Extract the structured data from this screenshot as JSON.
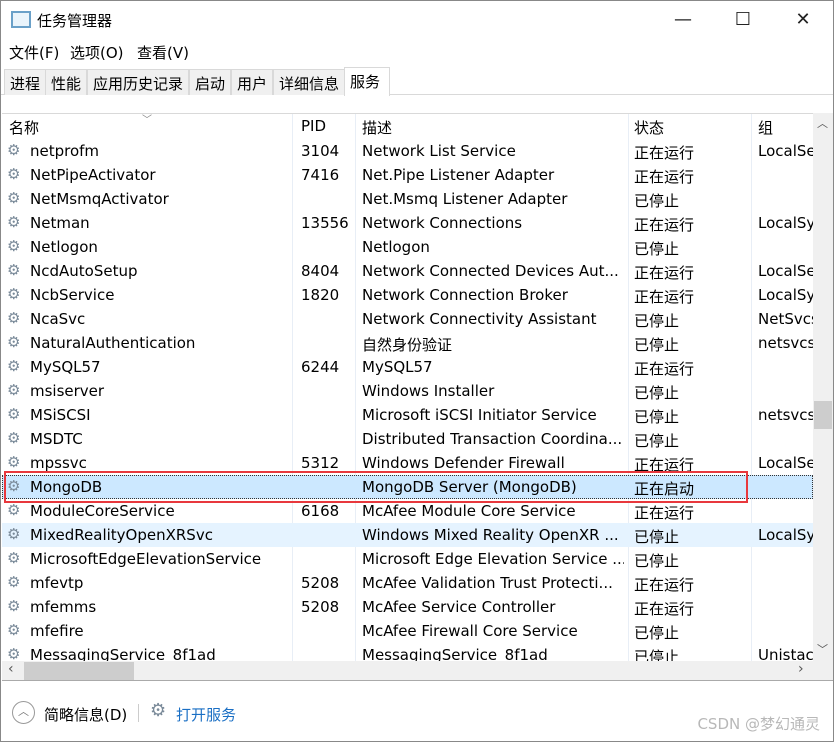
{
  "window": {
    "title": "任务管理器",
    "minimize": "—",
    "maximize": "☐",
    "close": "✕"
  },
  "menu": [
    "文件(F)",
    "选项(O)",
    "查看(V)"
  ],
  "tabs": [
    "进程",
    "性能",
    "应用历史记录",
    "启动",
    "用户",
    "详细信息",
    "服务"
  ],
  "active_tab": "服务",
  "columns": [
    "名称",
    "PID",
    "描述",
    "状态",
    "组"
  ],
  "rows": [
    [
      "netprofm",
      "3104",
      "Network List Service",
      "正在运行",
      "LocalSe"
    ],
    [
      "NetPipeActivator",
      "7416",
      "Net.Pipe Listener Adapter",
      "正在运行",
      ""
    ],
    [
      "NetMsmqActivator",
      "",
      "Net.Msmq Listener Adapter",
      "已停止",
      ""
    ],
    [
      "Netman",
      "13556",
      "Network Connections",
      "正在运行",
      "LocalSy"
    ],
    [
      "Netlogon",
      "",
      "Netlogon",
      "已停止",
      ""
    ],
    [
      "NcdAutoSetup",
      "8404",
      "Network Connected Devices Aut...",
      "正在运行",
      "LocalSe"
    ],
    [
      "NcbService",
      "1820",
      "Network Connection Broker",
      "正在运行",
      "LocalSy"
    ],
    [
      "NcaSvc",
      "",
      "Network Connectivity Assistant",
      "已停止",
      "NetSvcs"
    ],
    [
      "NaturalAuthentication",
      "",
      "自然身份验证",
      "已停止",
      "netsvcs"
    ],
    [
      "MySQL57",
      "6244",
      "MySQL57",
      "正在运行",
      ""
    ],
    [
      "msiserver",
      "",
      "Windows Installer",
      "已停止",
      ""
    ],
    [
      "MSiSCSI",
      "",
      "Microsoft iSCSI Initiator Service",
      "已停止",
      "netsvcs"
    ],
    [
      "MSDTC",
      "",
      "Distributed Transaction Coordina...",
      "已停止",
      ""
    ],
    [
      "mpssvc",
      "5312",
      "Windows Defender Firewall",
      "正在运行",
      "LocalSe"
    ],
    [
      "MongoDB",
      "",
      "MongoDB Server (MongoDB)",
      "正在启动",
      ""
    ],
    [
      "ModuleCoreService",
      "6168",
      "McAfee Module Core Service",
      "正在运行",
      ""
    ],
    [
      "MixedRealityOpenXRSvc",
      "",
      "Windows Mixed Reality OpenXR ...",
      "已停止",
      "LocalSy"
    ],
    [
      "MicrosoftEdgeElevationService",
      "",
      "Microsoft Edge Elevation Service ...",
      "已停止",
      ""
    ],
    [
      "mfevtp",
      "5208",
      "McAfee Validation Trust Protecti...",
      "正在运行",
      ""
    ],
    [
      "mfemms",
      "5208",
      "McAfee Service Controller",
      "正在运行",
      ""
    ],
    [
      "mfefire",
      "",
      "McAfee Firewall Core Service",
      "已停止",
      ""
    ],
    [
      "MessagingService_8f1ad",
      "",
      "MessagingService_8f1ad",
      "已停止",
      "Unistac"
    ]
  ],
  "selected_row": "MongoDB",
  "hover_row": "MixedRealityOpenXRSvc",
  "footer": {
    "fewer_details": "简略信息(D)",
    "open_services": "打开服务"
  },
  "watermark": "CSDN @梦幻通灵",
  "colors": {
    "selected": "#cce8ff",
    "hover": "#e5f3ff",
    "highlight_box": "#e8383d",
    "link": "#1a6fc4"
  }
}
